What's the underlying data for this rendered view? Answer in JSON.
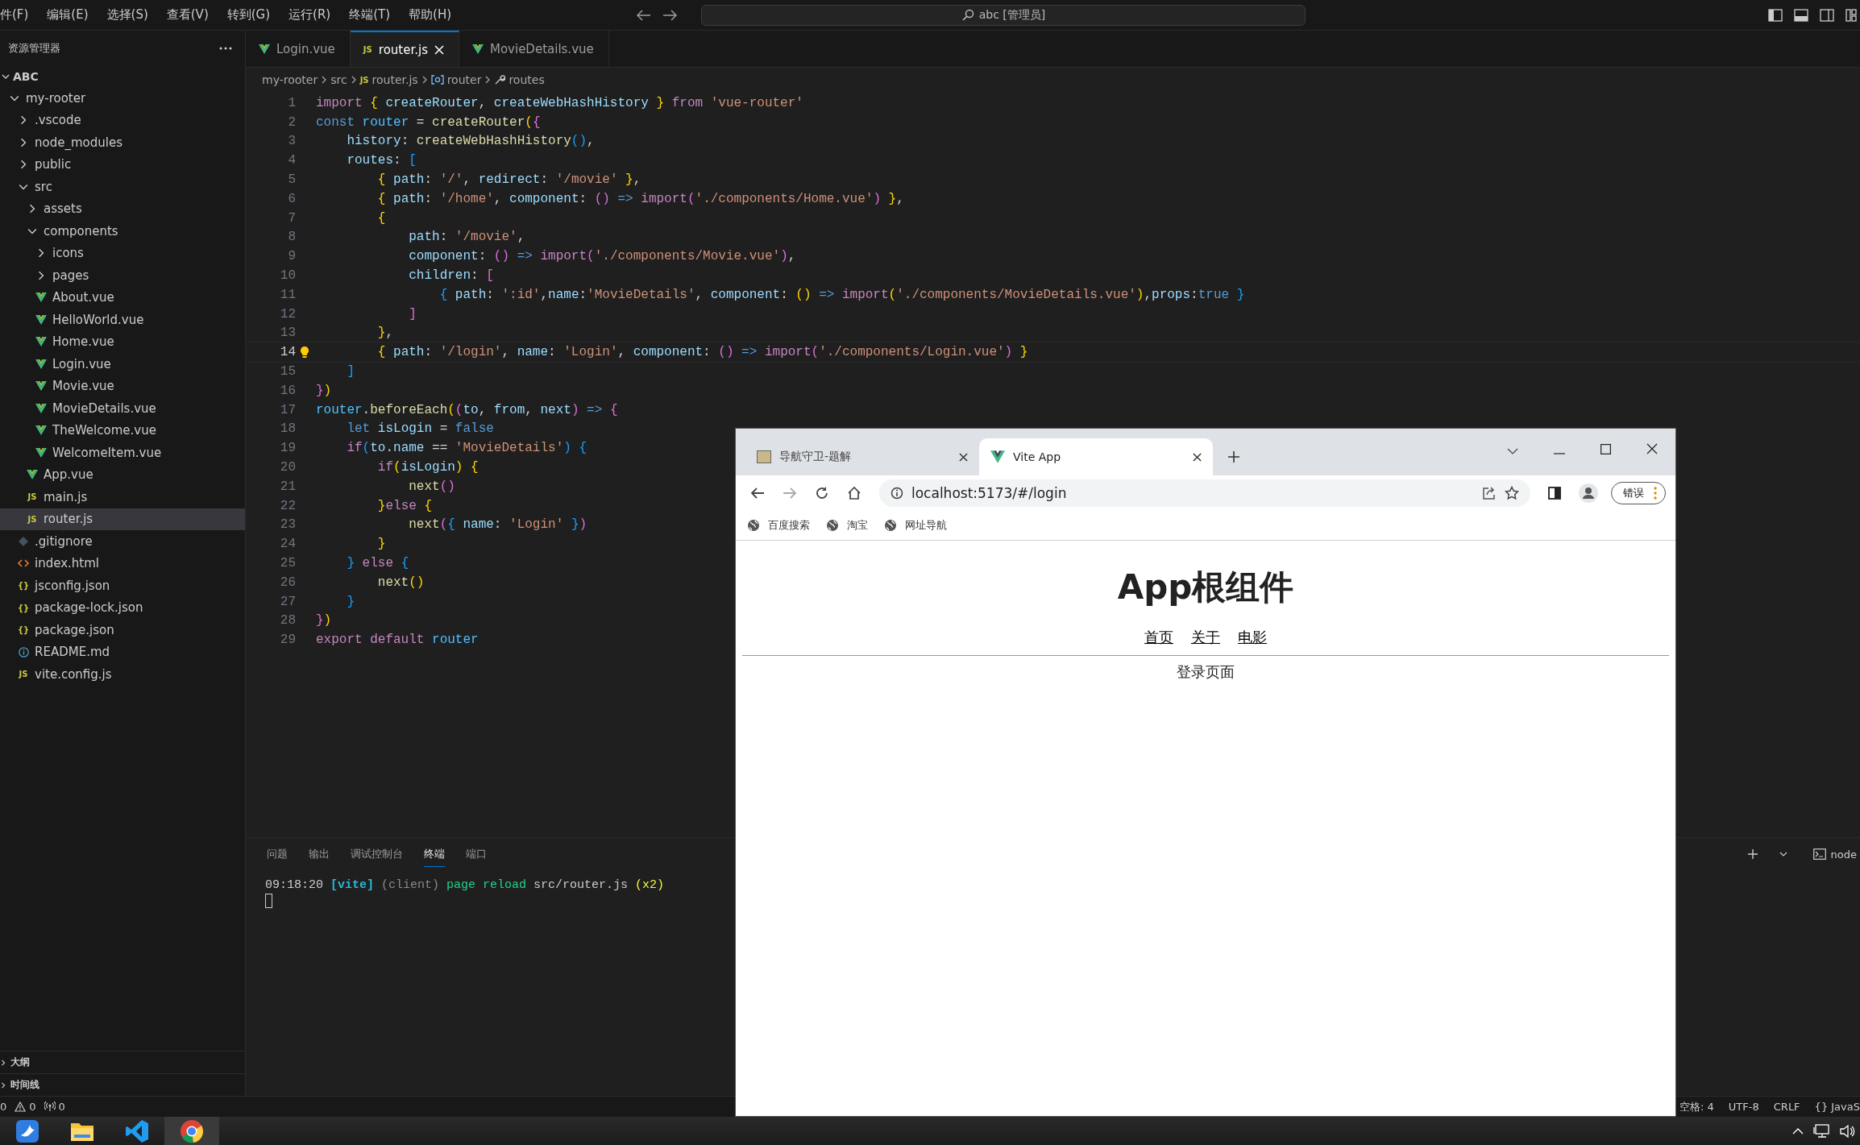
{
  "menu_bar": {
    "items": [
      "件(F)",
      "编辑(E)",
      "选择(S)",
      "查看(V)",
      "转到(G)",
      "运行(R)",
      "终端(T)",
      "帮助(H)"
    ],
    "search": {
      "value": "abc [管理员]"
    }
  },
  "sidebar": {
    "title": "资源管理器",
    "workspace": {
      "label": "ABC",
      "expanded": true
    },
    "tree": [
      {
        "kind": "folder",
        "label": "my-rooter",
        "expanded": true,
        "selected": false,
        "children": [
          {
            "kind": "folder",
            "label": ".vscode",
            "expanded": false,
            "selected": false
          },
          {
            "kind": "folder",
            "label": "node_modules",
            "expanded": false,
            "selected": false
          },
          {
            "kind": "folder",
            "label": "public",
            "expanded": false,
            "selected": false
          },
          {
            "kind": "folder",
            "label": "src",
            "expanded": true,
            "selected": false,
            "children": [
              {
                "kind": "folder",
                "label": "assets",
                "expanded": false,
                "selected": false
              },
              {
                "kind": "folder",
                "label": "components",
                "expanded": true,
                "selected": false,
                "children": [
                  {
                    "kind": "folder",
                    "label": "icons",
                    "expanded": false,
                    "selected": false
                  },
                  {
                    "kind": "folder",
                    "label": "pages",
                    "expanded": false,
                    "selected": false
                  },
                  {
                    "kind": "vue",
                    "label": "About.vue",
                    "selected": false
                  },
                  {
                    "kind": "vue",
                    "label": "HelloWorld.vue",
                    "selected": false
                  },
                  {
                    "kind": "vue",
                    "label": "Home.vue",
                    "selected": false
                  },
                  {
                    "kind": "vue",
                    "label": "Login.vue",
                    "selected": false
                  },
                  {
                    "kind": "vue",
                    "label": "Movie.vue",
                    "selected": false
                  },
                  {
                    "kind": "vue",
                    "label": "MovieDetails.vue",
                    "selected": false
                  },
                  {
                    "kind": "vue",
                    "label": "TheWelcome.vue",
                    "selected": false
                  },
                  {
                    "kind": "vue",
                    "label": "WelcomeItem.vue",
                    "selected": false
                  }
                ]
              },
              {
                "kind": "vue",
                "label": "App.vue",
                "selected": false
              },
              {
                "kind": "script",
                "icon_label": "JS",
                "label": "main.js",
                "selected": false
              },
              {
                "kind": "script",
                "icon_label": "JS",
                "label": "router.js",
                "selected": true
              }
            ]
          },
          {
            "kind": "ignore",
            "label": ".gitignore",
            "selected": false
          },
          {
            "kind": "markup",
            "label": "index.html",
            "selected": false
          },
          {
            "kind": "data",
            "icon_label": "{}",
            "label": "jsconfig.json",
            "selected": false
          },
          {
            "kind": "data",
            "icon_label": "{}",
            "label": "package-lock.json",
            "selected": false
          },
          {
            "kind": "data",
            "icon_label": "{}",
            "label": "package.json",
            "selected": false
          },
          {
            "kind": "readme",
            "label": "README.md",
            "selected": false
          },
          {
            "kind": "script",
            "icon_label": "JS",
            "label": "vite.config.js",
            "selected": false
          }
        ]
      }
    ],
    "sections": [
      {
        "label": "大纲",
        "expanded": false
      },
      {
        "label": "时间线",
        "expanded": false
      }
    ]
  },
  "editor": {
    "tabs": [
      {
        "kind": "vue",
        "label": "Login.vue",
        "selected": false
      },
      {
        "kind": "script",
        "icon_label": "JS",
        "label": "router.js",
        "selected": true
      },
      {
        "kind": "vue",
        "label": "MovieDetails.vue",
        "selected": false
      }
    ],
    "breadcrumb": [
      {
        "kind": "folder",
        "text": "my-rooter"
      },
      {
        "kind": "folder",
        "text": "src"
      },
      {
        "kind": "script",
        "icon_label": "JS",
        "text": "router.js"
      },
      {
        "kind": "variable",
        "text": "router"
      },
      {
        "kind": "property",
        "text": "routes"
      }
    ],
    "lines": [
      {
        "n": "1",
        "current": false,
        "tokens": [
          {
            "kind": "ctl",
            "text": "import"
          },
          {
            "kind": "b1",
            "text": " {"
          },
          {
            "kind": "var",
            "text": " createRouter"
          },
          {
            "kind": "p",
            "text": ", "
          },
          {
            "kind": "var",
            "text": "createWebHashHistory"
          },
          {
            "kind": "b1",
            "text": " }"
          },
          {
            "kind": "ctl",
            "text": " from"
          },
          {
            "kind": "str",
            "text": " 'vue-router'"
          }
        ]
      },
      {
        "n": "2",
        "current": false,
        "tokens": [
          {
            "kind": "kw",
            "text": "const"
          },
          {
            "kind": "cst",
            "text": " router"
          },
          {
            "kind": "p",
            "text": " = "
          },
          {
            "kind": "fn",
            "text": "createRouter"
          },
          {
            "kind": "b1",
            "text": "("
          },
          {
            "kind": "b2",
            "text": "{"
          }
        ]
      },
      {
        "n": "3",
        "current": false,
        "tokens": [
          {
            "kind": "var",
            "text": "    history"
          },
          {
            "kind": "p",
            "text": ": "
          },
          {
            "kind": "fn",
            "text": "createWebHashHistory"
          },
          {
            "kind": "b3",
            "text": "()"
          },
          {
            "kind": "p",
            "text": ","
          }
        ]
      },
      {
        "n": "4",
        "current": false,
        "tokens": [
          {
            "kind": "var",
            "text": "    routes"
          },
          {
            "kind": "p",
            "text": ": "
          },
          {
            "kind": "b3",
            "text": "["
          }
        ]
      },
      {
        "n": "5",
        "current": false,
        "tokens": [
          {
            "kind": "b1",
            "text": "        {"
          },
          {
            "kind": "var",
            "text": " path"
          },
          {
            "kind": "p",
            "text": ": "
          },
          {
            "kind": "str",
            "text": "'/'"
          },
          {
            "kind": "p",
            "text": ", "
          },
          {
            "kind": "var",
            "text": "redirect"
          },
          {
            "kind": "p",
            "text": ": "
          },
          {
            "kind": "str",
            "text": "'/movie'"
          },
          {
            "kind": "b1",
            "text": " }"
          },
          {
            "kind": "p",
            "text": ","
          }
        ]
      },
      {
        "n": "6",
        "current": false,
        "tokens": [
          {
            "kind": "b1",
            "text": "        {"
          },
          {
            "kind": "var",
            "text": " path"
          },
          {
            "kind": "p",
            "text": ": "
          },
          {
            "kind": "str",
            "text": "'/home'"
          },
          {
            "kind": "p",
            "text": ", "
          },
          {
            "kind": "var",
            "text": "component"
          },
          {
            "kind": "p",
            "text": ": "
          },
          {
            "kind": "b2",
            "text": "()"
          },
          {
            "kind": "kw",
            "text": " =>"
          },
          {
            "kind": "ctl",
            "text": " import"
          },
          {
            "kind": "b2",
            "text": "("
          },
          {
            "kind": "str",
            "text": "'./components/Home.vue'"
          },
          {
            "kind": "b2",
            "text": ")"
          },
          {
            "kind": "b1",
            "text": " }"
          },
          {
            "kind": "p",
            "text": ","
          }
        ]
      },
      {
        "n": "7",
        "current": false,
        "tokens": [
          {
            "kind": "b1",
            "text": "        {"
          }
        ]
      },
      {
        "n": "8",
        "current": false,
        "tokens": [
          {
            "kind": "var",
            "text": "            path"
          },
          {
            "kind": "p",
            "text": ": "
          },
          {
            "kind": "str",
            "text": "'/movie'"
          },
          {
            "kind": "p",
            "text": ","
          }
        ]
      },
      {
        "n": "9",
        "current": false,
        "tokens": [
          {
            "kind": "var",
            "text": "            component"
          },
          {
            "kind": "p",
            "text": ": "
          },
          {
            "kind": "b2",
            "text": "()"
          },
          {
            "kind": "kw",
            "text": " =>"
          },
          {
            "kind": "ctl",
            "text": " import"
          },
          {
            "kind": "b2",
            "text": "("
          },
          {
            "kind": "str",
            "text": "'./components/Movie.vue'"
          },
          {
            "kind": "b2",
            "text": ")"
          },
          {
            "kind": "p",
            "text": ","
          }
        ]
      },
      {
        "n": "10",
        "current": false,
        "tokens": [
          {
            "kind": "var",
            "text": "            children"
          },
          {
            "kind": "p",
            "text": ": "
          },
          {
            "kind": "b2",
            "text": "["
          }
        ]
      },
      {
        "n": "11",
        "current": false,
        "tokens": [
          {
            "kind": "b3",
            "text": "                {"
          },
          {
            "kind": "var",
            "text": " path"
          },
          {
            "kind": "p",
            "text": ": "
          },
          {
            "kind": "str",
            "text": "':id'"
          },
          {
            "kind": "p",
            "text": ","
          },
          {
            "kind": "var",
            "text": "name"
          },
          {
            "kind": "p",
            "text": ":"
          },
          {
            "kind": "str",
            "text": "'MovieDetails'"
          },
          {
            "kind": "p",
            "text": ", "
          },
          {
            "kind": "var",
            "text": "component"
          },
          {
            "kind": "p",
            "text": ": "
          },
          {
            "kind": "b1",
            "text": "()"
          },
          {
            "kind": "kw",
            "text": " =>"
          },
          {
            "kind": "ctl",
            "text": " import"
          },
          {
            "kind": "b1",
            "text": "("
          },
          {
            "kind": "str",
            "text": "'./components/MovieDetails.vue'"
          },
          {
            "kind": "b1",
            "text": ")"
          },
          {
            "kind": "p",
            "text": ","
          },
          {
            "kind": "var",
            "text": "props"
          },
          {
            "kind": "p",
            "text": ":"
          },
          {
            "kind": "kw",
            "text": "true"
          },
          {
            "kind": "b3",
            "text": " }"
          }
        ]
      },
      {
        "n": "12",
        "current": false,
        "tokens": [
          {
            "kind": "b2",
            "text": "            ]"
          }
        ]
      },
      {
        "n": "13",
        "current": false,
        "tokens": [
          {
            "kind": "b1",
            "text": "        }"
          },
          {
            "kind": "p",
            "text": ","
          }
        ]
      },
      {
        "n": "14",
        "current": true,
        "tokens": [
          {
            "kind": "b1",
            "text": "        {"
          },
          {
            "kind": "var",
            "text": " path"
          },
          {
            "kind": "p",
            "text": ": "
          },
          {
            "kind": "str",
            "text": "'/login'"
          },
          {
            "kind": "p",
            "text": ", "
          },
          {
            "kind": "var",
            "text": "name"
          },
          {
            "kind": "p",
            "text": ": "
          },
          {
            "kind": "str",
            "text": "'Login'"
          },
          {
            "kind": "p",
            "text": ", "
          },
          {
            "kind": "var",
            "text": "component"
          },
          {
            "kind": "p",
            "text": ": "
          },
          {
            "kind": "b2",
            "text": "()"
          },
          {
            "kind": "kw",
            "text": " =>"
          },
          {
            "kind": "ctl",
            "text": " import"
          },
          {
            "kind": "b2",
            "text": "("
          },
          {
            "kind": "str",
            "text": "'./components/Login.vue'"
          },
          {
            "kind": "b2",
            "text": ")"
          },
          {
            "kind": "b1",
            "text": " }"
          }
        ]
      },
      {
        "n": "15",
        "current": false,
        "tokens": [
          {
            "kind": "b3",
            "text": "    ]"
          }
        ]
      },
      {
        "n": "16",
        "current": false,
        "tokens": [
          {
            "kind": "b2",
            "text": "}"
          },
          {
            "kind": "b1",
            "text": ")"
          }
        ]
      },
      {
        "n": "17",
        "current": false,
        "tokens": [
          {
            "kind": "cst",
            "text": "router"
          },
          {
            "kind": "p",
            "text": "."
          },
          {
            "kind": "fn",
            "text": "beforeEach"
          },
          {
            "kind": "b1",
            "text": "("
          },
          {
            "kind": "b2",
            "text": "("
          },
          {
            "kind": "var",
            "text": "to"
          },
          {
            "kind": "p",
            "text": ", "
          },
          {
            "kind": "var",
            "text": "from"
          },
          {
            "kind": "p",
            "text": ", "
          },
          {
            "kind": "var",
            "text": "next"
          },
          {
            "kind": "b2",
            "text": ")"
          },
          {
            "kind": "kw",
            "text": " =>"
          },
          {
            "kind": "b2",
            "text": " {"
          }
        ]
      },
      {
        "n": "18",
        "current": false,
        "tokens": [
          {
            "kind": "kw",
            "text": "    let"
          },
          {
            "kind": "var",
            "text": " isLogin"
          },
          {
            "kind": "p",
            "text": " = "
          },
          {
            "kind": "kw",
            "text": "false"
          }
        ]
      },
      {
        "n": "19",
        "current": false,
        "tokens": [
          {
            "kind": "ctl",
            "text": "    if"
          },
          {
            "kind": "b3",
            "text": "("
          },
          {
            "kind": "var",
            "text": "to"
          },
          {
            "kind": "p",
            "text": "."
          },
          {
            "kind": "var",
            "text": "name"
          },
          {
            "kind": "p",
            "text": " == "
          },
          {
            "kind": "str",
            "text": "'MovieDetails'"
          },
          {
            "kind": "b3",
            "text": ")"
          },
          {
            "kind": "b3",
            "text": " {"
          }
        ]
      },
      {
        "n": "20",
        "current": false,
        "tokens": [
          {
            "kind": "ctl",
            "text": "        if"
          },
          {
            "kind": "b1",
            "text": "("
          },
          {
            "kind": "var",
            "text": "isLogin"
          },
          {
            "kind": "b1",
            "text": ")"
          },
          {
            "kind": "b1",
            "text": " {"
          }
        ]
      },
      {
        "n": "21",
        "current": false,
        "tokens": [
          {
            "kind": "fn",
            "text": "            next"
          },
          {
            "kind": "b2",
            "text": "()"
          }
        ]
      },
      {
        "n": "22",
        "current": false,
        "tokens": [
          {
            "kind": "b1",
            "text": "        }"
          },
          {
            "kind": "ctl",
            "text": "else"
          },
          {
            "kind": "b1",
            "text": " {"
          }
        ]
      },
      {
        "n": "23",
        "current": false,
        "tokens": [
          {
            "kind": "fn",
            "text": "            next"
          },
          {
            "kind": "b2",
            "text": "("
          },
          {
            "kind": "b3",
            "text": "{"
          },
          {
            "kind": "var",
            "text": " name"
          },
          {
            "kind": "p",
            "text": ": "
          },
          {
            "kind": "str",
            "text": "'Login'"
          },
          {
            "kind": "b3",
            "text": " }"
          },
          {
            "kind": "b2",
            "text": ")"
          }
        ]
      },
      {
        "n": "24",
        "current": false,
        "tokens": [
          {
            "kind": "b1",
            "text": "        }"
          }
        ]
      },
      {
        "n": "25",
        "current": false,
        "tokens": [
          {
            "kind": "b3",
            "text": "    }"
          },
          {
            "kind": "ctl",
            "text": " else"
          },
          {
            "kind": "b3",
            "text": " {"
          }
        ]
      },
      {
        "n": "26",
        "current": false,
        "tokens": [
          {
            "kind": "fn",
            "text": "        next"
          },
          {
            "kind": "b1",
            "text": "()"
          }
        ]
      },
      {
        "n": "27",
        "current": false,
        "tokens": [
          {
            "kind": "b3",
            "text": "    }"
          }
        ]
      },
      {
        "n": "28",
        "current": false,
        "tokens": [
          {
            "kind": "b2",
            "text": "}"
          },
          {
            "kind": "b1",
            "text": ")"
          }
        ]
      },
      {
        "n": "29",
        "current": false,
        "tokens": [
          {
            "kind": "ctl",
            "text": "export"
          },
          {
            "kind": "ctl",
            "text": " default"
          },
          {
            "kind": "cst",
            "text": " router"
          }
        ]
      }
    ]
  },
  "panel": {
    "tabs": [
      {
        "label": "问题",
        "selected": false
      },
      {
        "label": "输出",
        "selected": false
      },
      {
        "label": "调试控制台",
        "selected": false
      },
      {
        "label": "终端",
        "selected": true
      },
      {
        "label": "端口",
        "selected": false
      }
    ],
    "terminal_name": "node",
    "terminal": [
      {
        "kind": "time",
        "text": "09:18:20"
      },
      {
        "kind": "tag",
        "text": " [vite]"
      },
      {
        "kind": "dim",
        "text": " (client)"
      },
      {
        "kind": "ok",
        "text": " page reload"
      },
      {
        "kind": "time",
        "text": " src/router.js"
      },
      {
        "kind": "warn",
        "text": " (x2)"
      }
    ]
  },
  "status_bar": {
    "left": [
      {
        "kind": "plain",
        "text": "0"
      },
      {
        "kind": "warning",
        "text": "0"
      },
      {
        "kind": "broadcast",
        "text": "0"
      }
    ],
    "right": [
      "空格: 4",
      "UTF-8",
      "CRLF",
      "{} JavaS"
    ]
  },
  "taskbar": {
    "apps": [
      {
        "kind": "app",
        "selected": false
      },
      {
        "kind": "folder",
        "selected": false
      },
      {
        "kind": "editor",
        "selected": false
      },
      {
        "kind": "browser",
        "selected": true
      }
    ]
  },
  "browser": {
    "tabs": [
      {
        "kind": "image",
        "label": "导航守卫-题解",
        "selected": false
      },
      {
        "kind": "vite",
        "label": "Vite App",
        "selected": true
      }
    ],
    "url": "localhost:5173/#/login",
    "profile_button": "错误",
    "bookmarks": [
      "百度搜索",
      "淘宝",
      "网址导航"
    ],
    "page": {
      "heading": "App根组件",
      "nav": [
        "首页",
        "关于",
        "电影"
      ],
      "content": "登录页面"
    }
  }
}
